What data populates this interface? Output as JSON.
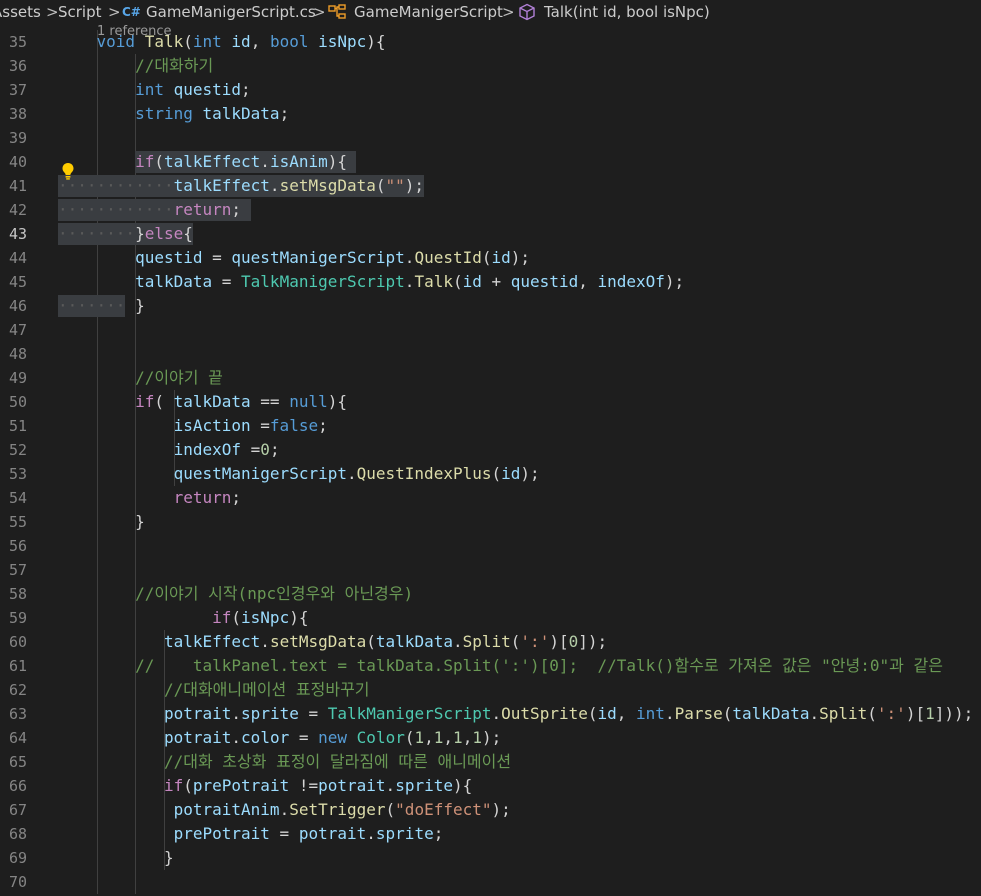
{
  "breadcrumb": {
    "items": [
      "Assets",
      "Script",
      "GameManigerScript.cs",
      "GameManigerScript",
      "Talk(int id, bool isNpc)"
    ],
    "separator": ">",
    "csharp_icon_text": "C#"
  },
  "editor": {
    "codelens": "1 reference",
    "active_line": "43",
    "line_numbers": [
      "35",
      "36",
      "37",
      "38",
      "39",
      "40",
      "41",
      "42",
      "43",
      "44",
      "45",
      "46",
      "47",
      "48",
      "49",
      "50",
      "51",
      "52",
      "53",
      "54",
      "55",
      "56",
      "57",
      "58",
      "59",
      "60",
      "61",
      "62",
      "63",
      "64",
      "65",
      "66",
      "67",
      "68",
      "69",
      "70"
    ],
    "lines": [
      [
        [
          "    ",
          "pl"
        ],
        [
          "void",
          "kw"
        ],
        [
          " ",
          "pl"
        ],
        [
          "Talk",
          "fn"
        ],
        [
          "(",
          "pl"
        ],
        [
          "int",
          "kw"
        ],
        [
          " ",
          "pl"
        ],
        [
          "id",
          "var"
        ],
        [
          ", ",
          "pl"
        ],
        [
          "bool",
          "kw"
        ],
        [
          " ",
          "pl"
        ],
        [
          "isNpc",
          "var"
        ],
        [
          "){",
          "pl"
        ]
      ],
      [
        [
          "        ",
          "pl"
        ],
        [
          "//대화하기",
          "cm"
        ]
      ],
      [
        [
          "        ",
          "pl"
        ],
        [
          "int",
          "kw"
        ],
        [
          " ",
          "pl"
        ],
        [
          "questid",
          "var"
        ],
        [
          ";",
          "pl"
        ]
      ],
      [
        [
          "        ",
          "pl"
        ],
        [
          "string",
          "kw"
        ],
        [
          " ",
          "pl"
        ],
        [
          "talkData",
          "var"
        ],
        [
          ";",
          "pl"
        ]
      ],
      [],
      [
        [
          "        ",
          "pl"
        ],
        [
          "if",
          "ctl"
        ],
        [
          "(",
          "pl"
        ],
        [
          "talkEffect",
          "var"
        ],
        [
          ".",
          "pl"
        ],
        [
          "isAnim",
          "var"
        ],
        [
          "){",
          "pl"
        ]
      ],
      [
        [
          "            ",
          "pl"
        ],
        [
          "talkEffect",
          "var"
        ],
        [
          ".",
          "pl"
        ],
        [
          "setMsgData",
          "fn"
        ],
        [
          "(",
          "pl"
        ],
        [
          "\"\"",
          "str"
        ],
        [
          ");",
          "pl"
        ]
      ],
      [
        [
          "            ",
          "pl"
        ],
        [
          "return",
          "ctl"
        ],
        [
          ";",
          "pl"
        ]
      ],
      [
        [
          "        ",
          "pl"
        ],
        [
          "}",
          "pl"
        ],
        [
          "else",
          "ctl"
        ],
        [
          "{",
          "pl"
        ]
      ],
      [
        [
          "        ",
          "pl"
        ],
        [
          "questid",
          "var"
        ],
        [
          " = ",
          "pl"
        ],
        [
          "questManigerScript",
          "var"
        ],
        [
          ".",
          "pl"
        ],
        [
          "QuestId",
          "fn"
        ],
        [
          "(",
          "pl"
        ],
        [
          "id",
          "var"
        ],
        [
          ");",
          "pl"
        ]
      ],
      [
        [
          "        ",
          "pl"
        ],
        [
          "talkData",
          "var"
        ],
        [
          " = ",
          "pl"
        ],
        [
          "TalkManigerScript",
          "cls"
        ],
        [
          ".",
          "pl"
        ],
        [
          "Talk",
          "fn"
        ],
        [
          "(",
          "pl"
        ],
        [
          "id",
          "var"
        ],
        [
          " + ",
          "pl"
        ],
        [
          "questid",
          "var"
        ],
        [
          ", ",
          "pl"
        ],
        [
          "indexOf",
          "var"
        ],
        [
          ");",
          "pl"
        ]
      ],
      [
        [
          "        ",
          "pl"
        ],
        [
          "}",
          "pl"
        ]
      ],
      [],
      [],
      [
        [
          "        ",
          "pl"
        ],
        [
          "//이야기 끝",
          "cm"
        ]
      ],
      [
        [
          "        ",
          "pl"
        ],
        [
          "if",
          "ctl"
        ],
        [
          "( ",
          "pl"
        ],
        [
          "talkData",
          "var"
        ],
        [
          " == ",
          "pl"
        ],
        [
          "null",
          "kw"
        ],
        [
          "){",
          "pl"
        ]
      ],
      [
        [
          "            ",
          "pl"
        ],
        [
          "isAction",
          "var"
        ],
        [
          " =",
          "pl"
        ],
        [
          "false",
          "kw"
        ],
        [
          ";",
          "pl"
        ]
      ],
      [
        [
          "            ",
          "pl"
        ],
        [
          "indexOf",
          "var"
        ],
        [
          " =",
          "pl"
        ],
        [
          "0",
          "num"
        ],
        [
          ";",
          "pl"
        ]
      ],
      [
        [
          "            ",
          "pl"
        ],
        [
          "questManigerScript",
          "var"
        ],
        [
          ".",
          "pl"
        ],
        [
          "QuestIndexPlus",
          "fn"
        ],
        [
          "(",
          "pl"
        ],
        [
          "id",
          "var"
        ],
        [
          ");",
          "pl"
        ]
      ],
      [
        [
          "            ",
          "pl"
        ],
        [
          "return",
          "ctl"
        ],
        [
          ";",
          "pl"
        ]
      ],
      [
        [
          "        ",
          "pl"
        ],
        [
          "}",
          "pl"
        ]
      ],
      [],
      [],
      [
        [
          "        ",
          "pl"
        ],
        [
          "//이야기 시작(npc인경우와 아닌경우)",
          "cm"
        ]
      ],
      [
        [
          "                ",
          "pl"
        ],
        [
          "if",
          "ctl"
        ],
        [
          "(",
          "pl"
        ],
        [
          "isNpc",
          "var"
        ],
        [
          "){",
          "pl"
        ]
      ],
      [
        [
          "           ",
          "pl"
        ],
        [
          "talkEffect",
          "var"
        ],
        [
          ".",
          "pl"
        ],
        [
          "setMsgData",
          "fn"
        ],
        [
          "(",
          "pl"
        ],
        [
          "talkData",
          "var"
        ],
        [
          ".",
          "pl"
        ],
        [
          "Split",
          "fn"
        ],
        [
          "(",
          "pl"
        ],
        [
          "':'",
          "str"
        ],
        [
          ")[",
          "pl"
        ],
        [
          "0",
          "num"
        ],
        [
          "]);",
          "pl"
        ]
      ],
      [
        [
          "        ",
          "pl"
        ],
        [
          "//    talkPanel.text = talkData.Split(':')[0];  //Talk()함수로 가져온 값은 \"안녕:0\"과 같은",
          "cm"
        ]
      ],
      [
        [
          "           ",
          "pl"
        ],
        [
          "//대화애니메이션 표정바꾸기",
          "cm"
        ]
      ],
      [
        [
          "           ",
          "pl"
        ],
        [
          "potrait",
          "var"
        ],
        [
          ".",
          "pl"
        ],
        [
          "sprite",
          "var"
        ],
        [
          " = ",
          "pl"
        ],
        [
          "TalkManigerScript",
          "cls"
        ],
        [
          ".",
          "pl"
        ],
        [
          "OutSprite",
          "fn"
        ],
        [
          "(",
          "pl"
        ],
        [
          "id",
          "var"
        ],
        [
          ", ",
          "pl"
        ],
        [
          "int",
          "kw"
        ],
        [
          ".",
          "pl"
        ],
        [
          "Parse",
          "fn"
        ],
        [
          "(",
          "pl"
        ],
        [
          "talkData",
          "var"
        ],
        [
          ".",
          "pl"
        ],
        [
          "Split",
          "fn"
        ],
        [
          "(",
          "pl"
        ],
        [
          "':'",
          "str"
        ],
        [
          ")[",
          "pl"
        ],
        [
          "1",
          "num"
        ],
        [
          "]));",
          "pl"
        ]
      ],
      [
        [
          "           ",
          "pl"
        ],
        [
          "potrait",
          "var"
        ],
        [
          ".",
          "pl"
        ],
        [
          "color",
          "var"
        ],
        [
          " = ",
          "pl"
        ],
        [
          "new",
          "kw"
        ],
        [
          " ",
          "pl"
        ],
        [
          "Color",
          "cls"
        ],
        [
          "(",
          "pl"
        ],
        [
          "1",
          "num"
        ],
        [
          ",",
          "pl"
        ],
        [
          "1",
          "num"
        ],
        [
          ",",
          "pl"
        ],
        [
          "1",
          "num"
        ],
        [
          ",",
          "pl"
        ],
        [
          "1",
          "num"
        ],
        [
          ");",
          "pl"
        ]
      ],
      [
        [
          "           ",
          "pl"
        ],
        [
          "//대화 초상화 표정이 달라짐에 따른 애니메이션",
          "cm"
        ]
      ],
      [
        [
          "           ",
          "pl"
        ],
        [
          "if",
          "ctl"
        ],
        [
          "(",
          "pl"
        ],
        [
          "prePotrait",
          "var"
        ],
        [
          " !=",
          "pl"
        ],
        [
          "potrait",
          "var"
        ],
        [
          ".",
          "pl"
        ],
        [
          "sprite",
          "var"
        ],
        [
          "){",
          "pl"
        ]
      ],
      [
        [
          "            ",
          "pl"
        ],
        [
          "potraitAnim",
          "var"
        ],
        [
          ".",
          "pl"
        ],
        [
          "SetTrigger",
          "fn"
        ],
        [
          "(",
          "pl"
        ],
        [
          "\"doEffect\"",
          "str"
        ],
        [
          ");",
          "pl"
        ]
      ],
      [
        [
          "            ",
          "pl"
        ],
        [
          "prePotrait",
          "var"
        ],
        [
          " = ",
          "pl"
        ],
        [
          "potrait",
          "var"
        ],
        [
          ".",
          "pl"
        ],
        [
          "sprite",
          "var"
        ],
        [
          ";",
          "pl"
        ]
      ],
      [
        [
          "           ",
          "pl"
        ],
        [
          "}",
          "pl"
        ]
      ],
      []
    ]
  }
}
